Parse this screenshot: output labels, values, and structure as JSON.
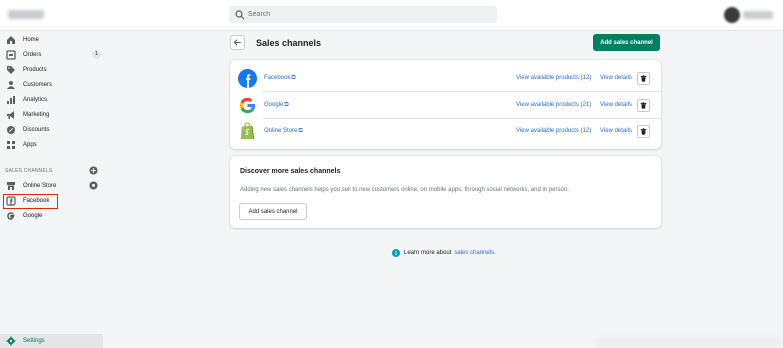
{
  "topbar": {
    "search_placeholder": "Search"
  },
  "sidebar": {
    "items": [
      {
        "label": "Home",
        "icon": "home-icon"
      },
      {
        "label": "Orders",
        "icon": "orders-icon",
        "badge": "1"
      },
      {
        "label": "Products",
        "icon": "tag-icon"
      },
      {
        "label": "Customers",
        "icon": "person-icon"
      },
      {
        "label": "Analytics",
        "icon": "bar-chart-icon"
      },
      {
        "label": "Marketing",
        "icon": "megaphone-icon"
      },
      {
        "label": "Discounts",
        "icon": "discount-icon"
      },
      {
        "label": "Apps",
        "icon": "apps-icon"
      }
    ],
    "sales_channels_title": "SALES CHANNELS",
    "channels": [
      {
        "label": "Online Store",
        "icon": "store-icon"
      },
      {
        "label": "Facebook",
        "icon": "facebook-icon"
      },
      {
        "label": "Google",
        "icon": "google-icon"
      }
    ],
    "settings_label": "Settings"
  },
  "main": {
    "title": "Sales channels",
    "add_channel_label": "Add sales channel",
    "channels": [
      {
        "name": "Facebook",
        "view_products": "View available products (12)",
        "view_details": "View details"
      },
      {
        "name": "Google",
        "view_products": "View available products (21)",
        "view_details": "View details"
      },
      {
        "name": "Online Store",
        "view_products": "View available products (12)",
        "view_details": "View details"
      }
    ],
    "discover": {
      "title": "Discover more sales channels",
      "description": "Adding new sales channels helps you sell to new customers online, on mobile apps, through social networks, and in person.",
      "button_label": "Add sales channel"
    },
    "learn_more": {
      "text": "Learn more about",
      "link": "sales channels."
    }
  },
  "colors": {
    "primary_green": "#008060",
    "link_blue": "#2c6ecb",
    "highlight_red": "#d72c0d",
    "facebook_blue": "#1877f2",
    "shopify_green": "#95bf47"
  }
}
